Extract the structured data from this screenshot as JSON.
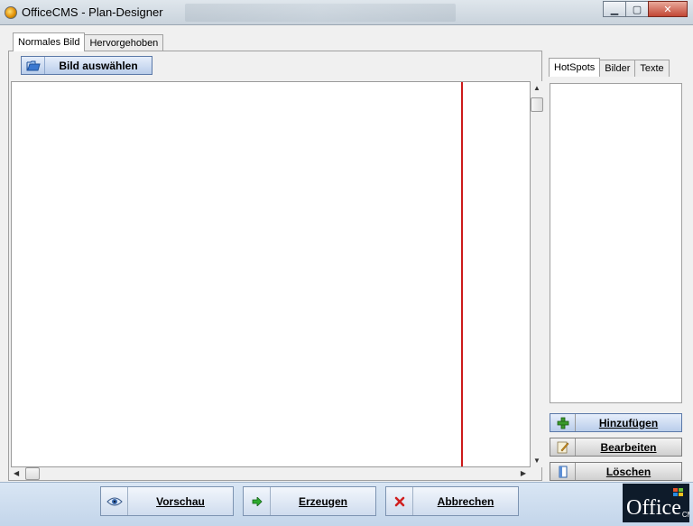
{
  "window": {
    "title": "OfficeCMS - Plan-Designer"
  },
  "tabs_top": [
    {
      "label": "Normales Bild"
    },
    {
      "label": "Hervorgehoben"
    }
  ],
  "toolbar": {
    "select_image_label": "Bild auswählen"
  },
  "tabs_right": [
    {
      "label": "HotSpots"
    },
    {
      "label": "Bilder"
    },
    {
      "label": "Texte"
    }
  ],
  "side_buttons": {
    "add": "Hinzufügen",
    "edit": "Bearbeiten",
    "delete": "Löschen"
  },
  "bottom_buttons": {
    "preview": "Vorschau",
    "create": "Erzeugen",
    "cancel": "Abbrechen"
  },
  "logo": {
    "word": "Office",
    "sub": "CMS"
  },
  "colors": {
    "accent_line": "#cc1a1a"
  }
}
